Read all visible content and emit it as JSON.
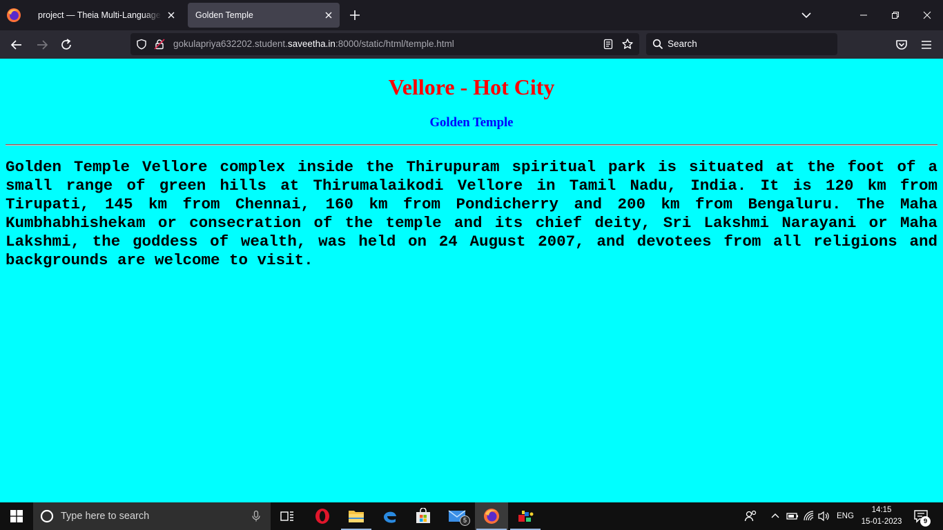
{
  "browser": {
    "tabs": [
      {
        "title": "project — Theia Multi-Language Ex",
        "active": false
      },
      {
        "title": "Golden Temple",
        "active": true
      }
    ],
    "url_prefix": "gokulapriya632202.student.",
    "url_domain": "saveetha.in",
    "url_suffix": ":8000/static/html/temple.html",
    "search_placeholder": "Search"
  },
  "page": {
    "heading": "Vellore - Hot City",
    "subheading": "Golden Temple",
    "paragraph": "Golden Temple Vellore complex inside the Thirupuram spiritual park is situated at the foot of a small range of green hills at Thirumalaikodi Vellore in Tamil Nadu, India. It is 120 km from Tirupati, 145 km from Chennai, 160 km from Pondicherry and 200 km from Bengaluru. The Maha Kumbhabhishekam or consecration of the temple and its chief deity, Sri Lakshmi Narayani or Maha Lakshmi, the goddess of wealth, was held on 24 August 2007, and devotees from all religions and backgrounds are welcome to visit.",
    "colors": {
      "background": "#00ffff",
      "heading": "#ff0000",
      "subheading": "#0000ff"
    }
  },
  "taskbar": {
    "search_placeholder": "Type here to search",
    "mail_badge": "5",
    "language": "ENG",
    "time": "14:15",
    "date": "15-01-2023",
    "notification_count": "9"
  }
}
